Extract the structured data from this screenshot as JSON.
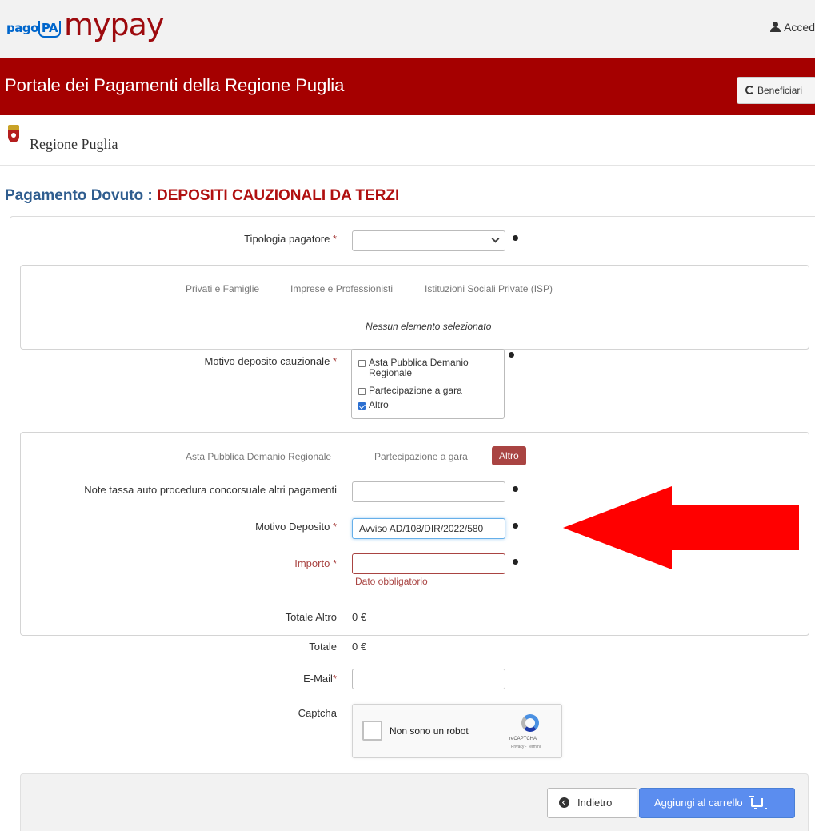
{
  "topbar": {
    "pagopa_logo": "pagoPA",
    "mypay_logo": "mypay",
    "access_label": "Acced"
  },
  "header": {
    "title": "Portale dei Pagamenti della Regione Puglia",
    "beneficiari_label": "Beneficiari"
  },
  "region": {
    "name": "Regione Puglia"
  },
  "page": {
    "heading_prefix": "Pagamento Dovuto : ",
    "service_name": "DEPOSITI CAUZIONALI DA TERZI"
  },
  "form": {
    "tipologia_label": "Tipologia pagatore",
    "tipologia_value": "",
    "payer_tabs": [
      "Privati e Famiglie",
      "Imprese e Professionisti",
      "Istituzioni Sociali Private (ISP)"
    ],
    "no_selection_text": "Nessun elemento selezionato",
    "motivo_label": "Motivo deposito cauzionale",
    "motivo_options": [
      {
        "label": "Asta Pubblica Demanio Regionale",
        "checked": false
      },
      {
        "label": "Partecipazione a gara",
        "checked": false
      },
      {
        "label": "Altro",
        "checked": true
      }
    ],
    "motivo_tabs": [
      "Asta Pubblica Demanio Regionale",
      "Partecipazione a gara",
      "Altro"
    ],
    "note_label": "Note tassa auto procedura concorsuale altri pagamenti",
    "note_value": "",
    "motivo_deposito_label": "Motivo Deposito",
    "motivo_deposito_value": "Avviso AD/108/DIR/2022/580",
    "importo_label": "Importo",
    "importo_value": "",
    "importo_error": "Dato obbligatorio",
    "totale_altro_label": "Totale Altro",
    "totale_altro_value": "0 €",
    "totale_label": "Totale",
    "totale_value": "0 €",
    "email_label": "E-Mail",
    "email_value": "",
    "captcha_label": "Captcha",
    "required_mark": "*"
  },
  "captcha": {
    "text": "Non sono un robot",
    "brand": "reCAPTCHA",
    "links": "Privacy - Termini"
  },
  "footer": {
    "back_label": "Indietro",
    "add_to_cart_label": "Aggiungi al carrello"
  },
  "colors": {
    "brand_red": "#a50000",
    "heading_blue": "#2f5d8f",
    "error_red": "#a94442",
    "primary_button": "#5b8def",
    "annotation_arrow": "#ff0000"
  }
}
